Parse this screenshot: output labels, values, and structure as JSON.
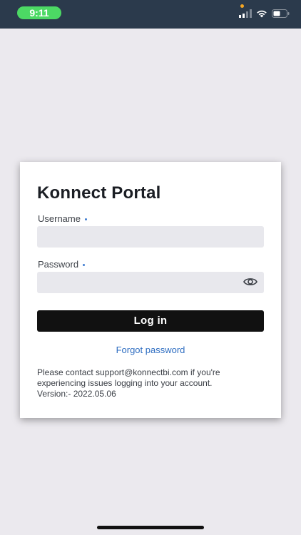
{
  "status_bar": {
    "time": "9:11",
    "icons": [
      "cellular-signal-icon",
      "wifi-icon",
      "battery-icon"
    ],
    "colors": {
      "background": "#2b3a4c",
      "time_pill": "#4cd964"
    }
  },
  "login": {
    "title": "Konnect Portal",
    "username_label": "Username",
    "username_value": "",
    "password_label": "Password",
    "password_value": "",
    "login_button": "Log in",
    "forgot_password": "Forgot password",
    "support_line1": "Please contact support@konnectbi.com if you're",
    "support_line2": "experiencing issues logging into your account.",
    "support_line3": "Version:- 2022.05.06"
  },
  "colors": {
    "page_background": "#ebe9ee",
    "button": "#111111",
    "link": "#2e6dc1",
    "input_background": "#e8e8ed"
  }
}
